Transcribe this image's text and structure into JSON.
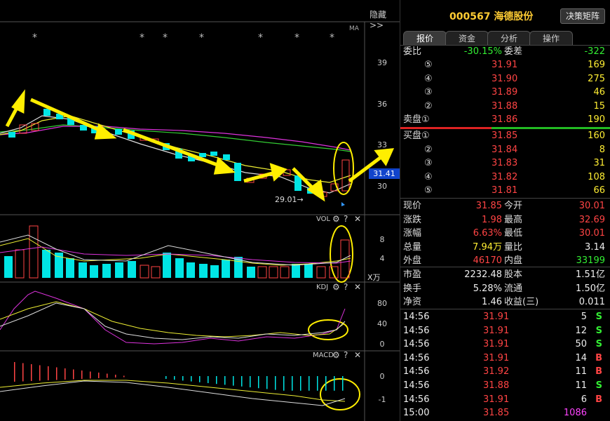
{
  "chart_header": {
    "hide_label": "隐藏>>",
    "ma_label": "MA"
  },
  "price_axis": {
    "ticks": [
      "39",
      "36",
      "33",
      "31.41",
      "30"
    ],
    "current": "31.41",
    "low_label": "29.01→"
  },
  "vol_panel": {
    "title": "VOL",
    "ticks": [
      "8",
      "4"
    ],
    "unit": "X万"
  },
  "kdj_panel": {
    "title": "KDJ",
    "ticks": [
      "80",
      "40",
      "0"
    ]
  },
  "macd_panel": {
    "title": "MACD",
    "ticks": [
      "0",
      "-1"
    ]
  },
  "stock": {
    "code_name": "000567 海德股份",
    "button": "决策矩阵"
  },
  "tabs": [
    "报价",
    "资金",
    "分析",
    "操作"
  ],
  "order_book": {
    "ratio_label": "委比",
    "ratio": "-30.15%",
    "diff_label": "委差",
    "diff": "-322",
    "sell": [
      {
        "label": "⑤",
        "price": "31.91",
        "vol": "169"
      },
      {
        "label": "④",
        "price": "31.90",
        "vol": "275"
      },
      {
        "label": "③",
        "price": "31.89",
        "vol": "46"
      },
      {
        "label": "②",
        "price": "31.88",
        "vol": "15"
      },
      {
        "label": "卖盘①",
        "price": "31.86",
        "vol": "190"
      }
    ],
    "buy": [
      {
        "label": "买盘①",
        "price": "31.85",
        "vol": "160"
      },
      {
        "label": "②",
        "price": "31.84",
        "vol": "8"
      },
      {
        "label": "③",
        "price": "31.83",
        "vol": "31"
      },
      {
        "label": "④",
        "price": "31.82",
        "vol": "108"
      },
      {
        "label": "⑤",
        "price": "31.81",
        "vol": "66"
      }
    ]
  },
  "quote": [
    {
      "l1": "现价",
      "v1": "31.85",
      "c1": "red",
      "l2": "今开",
      "v2": "30.01",
      "c2": "red"
    },
    {
      "l1": "涨跌",
      "v1": "1.98",
      "c1": "red",
      "l2": "最高",
      "v2": "32.69",
      "c2": "red"
    },
    {
      "l1": "涨幅",
      "v1": "6.63%",
      "c1": "red",
      "l2": "最低",
      "v2": "30.01",
      "c2": "red"
    },
    {
      "l1": "总量",
      "v1": "7.94万",
      "c1": "yellow",
      "l2": "量比",
      "v2": "3.14",
      "c2": "white"
    },
    {
      "l1": "外盘",
      "v1": "46170",
      "c1": "red",
      "l2": "内盘",
      "v2": "33199",
      "c2": "green"
    }
  ],
  "quote2": [
    {
      "l1": "市盈",
      "v1": "2232.48",
      "l2": "股本",
      "v2": "1.51亿"
    },
    {
      "l1": "换手",
      "v1": "5.28%",
      "l2": "流通",
      "v2": "1.50亿"
    },
    {
      "l1": "净资",
      "v1": "1.46",
      "l2": "收益(三)",
      "v2": "0.011"
    }
  ],
  "ticks": [
    {
      "time": "14:56",
      "price": "31.91",
      "vol": "5",
      "side": "S",
      "pc": "red",
      "sc": "green"
    },
    {
      "time": "14:56",
      "price": "31.91",
      "vol": "12",
      "side": "S",
      "pc": "red",
      "sc": "green"
    },
    {
      "time": "14:56",
      "price": "31.91",
      "vol": "50",
      "side": "S",
      "pc": "red",
      "sc": "green"
    },
    {
      "time": "14:56",
      "price": "31.91",
      "vol": "14",
      "side": "B",
      "pc": "red",
      "sc": "red"
    },
    {
      "time": "14:56",
      "price": "31.92",
      "vol": "11",
      "side": "B",
      "pc": "red",
      "sc": "red"
    },
    {
      "time": "14:56",
      "price": "31.88",
      "vol": "11",
      "side": "S",
      "pc": "red",
      "sc": "green"
    },
    {
      "time": "14:56",
      "price": "31.91",
      "vol": "6",
      "side": "B",
      "pc": "red",
      "sc": "red"
    },
    {
      "time": "15:00",
      "price": "31.85",
      "vol": "1086",
      "side": "",
      "pc": "red",
      "sc": "magenta"
    }
  ]
}
